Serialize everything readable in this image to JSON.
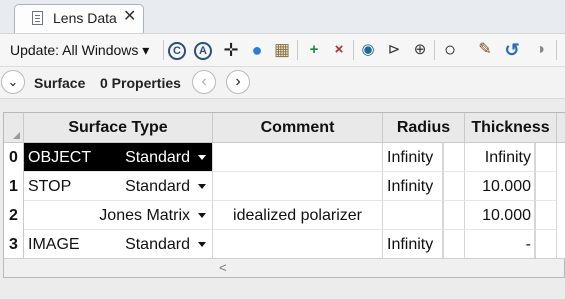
{
  "tab": {
    "title": "Lens Data",
    "close_glyph": "✕"
  },
  "toolbar": {
    "update_label": "Update: All Windows ▾",
    "icons": [
      {
        "name": "refresh-all-icon",
        "glyph": "C"
      },
      {
        "name": "refresh-auto-icon",
        "glyph": "A"
      },
      {
        "name": "crosshair-icon",
        "glyph": "✛"
      },
      {
        "name": "globe-icon",
        "glyph": "●"
      },
      {
        "name": "image-icon",
        "glyph": "▦"
      },
      {
        "name": "insert-surface-icon",
        "glyph": "+"
      },
      {
        "name": "delete-surface-icon",
        "glyph": "×"
      },
      {
        "name": "lens-icon",
        "glyph": "◉"
      },
      {
        "name": "reverse-elements-icon",
        "glyph": "⊳"
      },
      {
        "name": "flip-icon",
        "glyph": "⊕"
      },
      {
        "name": "aperture-icon",
        "glyph": "○"
      },
      {
        "name": "wand-icon",
        "glyph": "✎"
      },
      {
        "name": "undo-icon",
        "glyph": "↺"
      },
      {
        "name": "toggle-icon",
        "glyph": "◑"
      }
    ]
  },
  "propbar": {
    "expand_glyph": "⌄",
    "surface_label": "Surface",
    "properties_label": "0 Properties",
    "prev_glyph": "‹",
    "next_glyph": "›"
  },
  "table": {
    "columns": {
      "surface_type": "Surface Type",
      "comment": "Comment",
      "radius": "Radius",
      "thickness": "Thickness"
    },
    "rows": [
      {
        "num": "0",
        "name": "OBJECT",
        "type": "Standard",
        "comment": "",
        "radius": "Infinity",
        "thickness": "Infinity"
      },
      {
        "num": "1",
        "name": "STOP",
        "type": "Standard",
        "comment": "",
        "radius": "Infinity",
        "thickness": "10.000"
      },
      {
        "num": "2",
        "name": "",
        "type": "Jones Matrix",
        "comment": "idealized polarizer",
        "radius": "",
        "thickness": "10.000"
      },
      {
        "num": "3",
        "name": "IMAGE",
        "type": "Standard",
        "comment": "",
        "radius": "Infinity",
        "thickness": "-"
      }
    ]
  },
  "scrollbar": {
    "left_arrow": "<"
  }
}
